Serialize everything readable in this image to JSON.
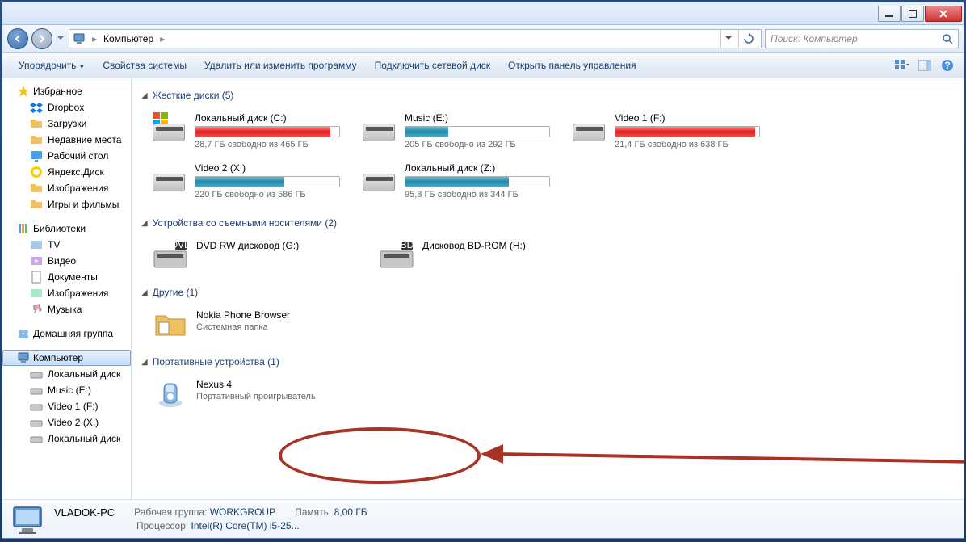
{
  "titlebar": {},
  "nav": {
    "breadcrumb_label": "Компьютер",
    "search_placeholder": "Поиск: Компьютер"
  },
  "toolbar": {
    "organize": "Упорядочить",
    "properties": "Свойства системы",
    "uninstall": "Удалить или изменить программу",
    "map_drive": "Подключить сетевой диск",
    "control_panel": "Открыть панель управления"
  },
  "sidebar": {
    "favorites": {
      "label": "Избранное",
      "items": [
        {
          "label": "Dropbox"
        },
        {
          "label": "Загрузки"
        },
        {
          "label": "Недавние места"
        },
        {
          "label": "Рабочий стол"
        },
        {
          "label": "Яндекс.Диск"
        },
        {
          "label": "Изображения"
        },
        {
          "label": "Игры и фильмы"
        }
      ]
    },
    "libraries": {
      "label": "Библиотеки",
      "items": [
        {
          "label": "TV"
        },
        {
          "label": "Видео"
        },
        {
          "label": "Документы"
        },
        {
          "label": "Изображения"
        },
        {
          "label": "Музыка"
        }
      ]
    },
    "homegroup": {
      "label": "Домашняя группа"
    },
    "computer": {
      "label": "Компьютер",
      "items": [
        {
          "label": "Локальный диск"
        },
        {
          "label": "Music (E:)"
        },
        {
          "label": "Video 1 (F:)"
        },
        {
          "label": "Video 2 (X:)"
        },
        {
          "label": "Локальный диск"
        }
      ]
    }
  },
  "content": {
    "hard_drives": {
      "label": "Жесткие диски (5)",
      "drives": [
        {
          "name": "Локальный диск (C:)",
          "free": "28,7 ГБ свободно из 465 ГБ",
          "pct": 94,
          "color": "red",
          "win": true
        },
        {
          "name": "Music (E:)",
          "free": "205 ГБ свободно из 292 ГБ",
          "pct": 30,
          "color": "blue"
        },
        {
          "name": "Video 1 (F:)",
          "free": "21,4 ГБ свободно из 638 ГБ",
          "pct": 97,
          "color": "red"
        },
        {
          "name": "Video 2 (X:)",
          "free": "220 ГБ свободно из 586 ГБ",
          "pct": 62,
          "color": "blue"
        },
        {
          "name": "Локальный диск (Z:)",
          "free": "95,8 ГБ свободно из 344 ГБ",
          "pct": 72,
          "color": "blue"
        }
      ]
    },
    "removable": {
      "label": "Устройства со съемными носителями (2)",
      "items": [
        {
          "name": "DVD RW дисковод (G:)",
          "badge": "DVD"
        },
        {
          "name": "Дисковод BD-ROM (H:)",
          "badge": "BD"
        }
      ]
    },
    "other": {
      "label": "Другие (1)",
      "items": [
        {
          "name": "Nokia Phone Browser",
          "sub": "Системная папка"
        }
      ]
    },
    "portable": {
      "label": "Портативные устройства (1)",
      "items": [
        {
          "name": "Nexus 4",
          "sub": "Портативный проигрыватель"
        }
      ]
    }
  },
  "statusbar": {
    "name": "VLADOK-PC",
    "workgroup_label": "Рабочая группа:",
    "workgroup": "WORKGROUP",
    "memory_label": "Память:",
    "memory": "8,00 ГБ",
    "cpu_label": "Процессор:",
    "cpu": "Intel(R) Core(TM) i5-25..."
  }
}
